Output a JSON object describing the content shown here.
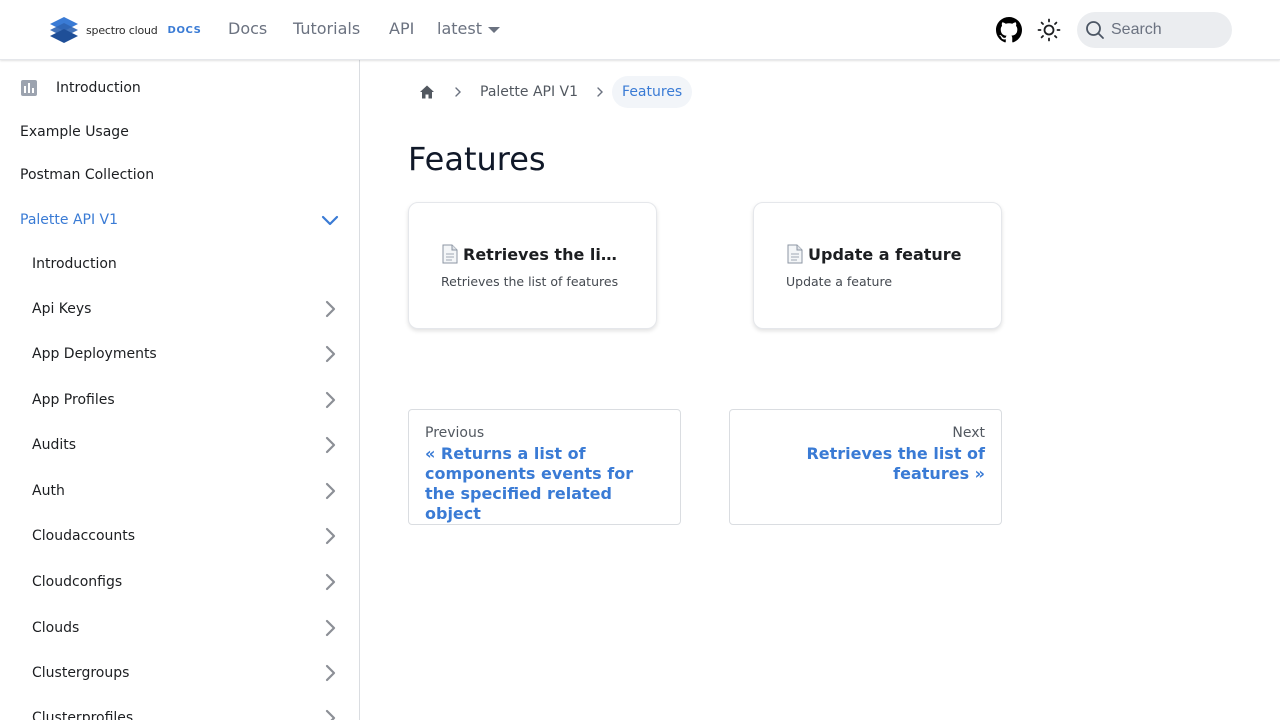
{
  "navbar": {
    "logo_text": "spectro cloud",
    "logo_badge": "DOCS",
    "links": {
      "docs": "Docs",
      "tutorials": "Tutorials",
      "api": "API",
      "version": "latest"
    },
    "search_placeholder": "Search"
  },
  "sidebar": {
    "top_items": [
      {
        "label": "Introduction"
      },
      {
        "label": "Example Usage"
      },
      {
        "label": "Postman Collection"
      },
      {
        "label": "Palette API V1"
      }
    ],
    "sub_items": [
      {
        "label": "Introduction"
      },
      {
        "label": "Api Keys"
      },
      {
        "label": "App Deployments"
      },
      {
        "label": "App Profiles"
      },
      {
        "label": "Audits"
      },
      {
        "label": "Auth"
      },
      {
        "label": "Cloudaccounts"
      },
      {
        "label": "Cloudconfigs"
      },
      {
        "label": "Clouds"
      },
      {
        "label": "Clustergroups"
      },
      {
        "label": "Clusterprofiles"
      }
    ]
  },
  "breadcrumbs": {
    "parent": "Palette API V1",
    "current": "Features"
  },
  "main": {
    "title": "Features",
    "cards": [
      {
        "title": "Retrieves the list o…",
        "description": "Retrieves the list of features"
      },
      {
        "title": "Update a feature",
        "description": "Update a feature"
      }
    ],
    "pager": {
      "previous": {
        "sub": "Previous",
        "label": "« Returns a list of components events for the specified related object"
      },
      "next": {
        "sub": "Next",
        "label": "Retrieves the list of features »"
      }
    }
  },
  "colors": {
    "accent": "#3a7bd5",
    "text": "#1c1e21",
    "muted": "#6b7280"
  }
}
